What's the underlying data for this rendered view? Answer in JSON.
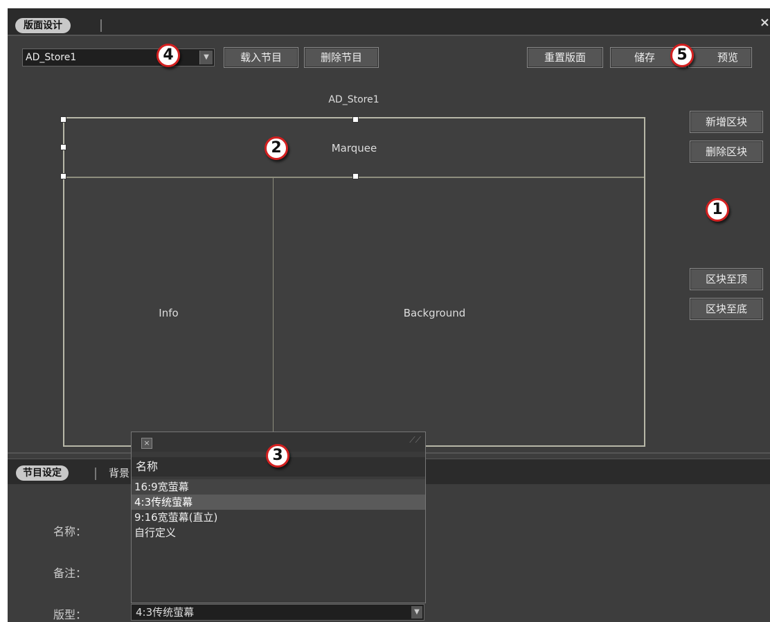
{
  "window": {
    "tab_title": "版面设计",
    "close_glyph": "×"
  },
  "toolbar": {
    "program_select_value": "AD_Store1",
    "load_label": "载入节目",
    "delete_label": "删除节目",
    "reset_label": "重置版面",
    "save_label": "储存",
    "preview_label": "预览"
  },
  "canvas": {
    "layout_name": "AD_Store1",
    "regions": {
      "marquee": "Marquee",
      "info": "Info",
      "background": "Background"
    }
  },
  "side_buttons": {
    "add_block": "新增区块",
    "delete_block": "删除区块",
    "block_top": "区块至顶",
    "block_bottom": "区块至底"
  },
  "badges": [
    "1",
    "2",
    "3",
    "4",
    "5"
  ],
  "bottom_panel": {
    "tab_active": "节目设定",
    "tab_second": "背景",
    "labels": {
      "name": "名称：",
      "note": "备注：",
      "type": "版型："
    },
    "type_value": "4:3传统萤幕"
  },
  "popup": {
    "close_glyph": "×",
    "header": "名称",
    "items": [
      "16:9宽萤幕",
      "4:3传统萤幕",
      "9:16宽萤幕(直立)",
      "自行定义"
    ],
    "selected_index": 1
  },
  "colors": {
    "badge_ring": "#d32020",
    "panel_bg": "#3d3d3d",
    "titlebar_bg": "#2b2b2b"
  }
}
